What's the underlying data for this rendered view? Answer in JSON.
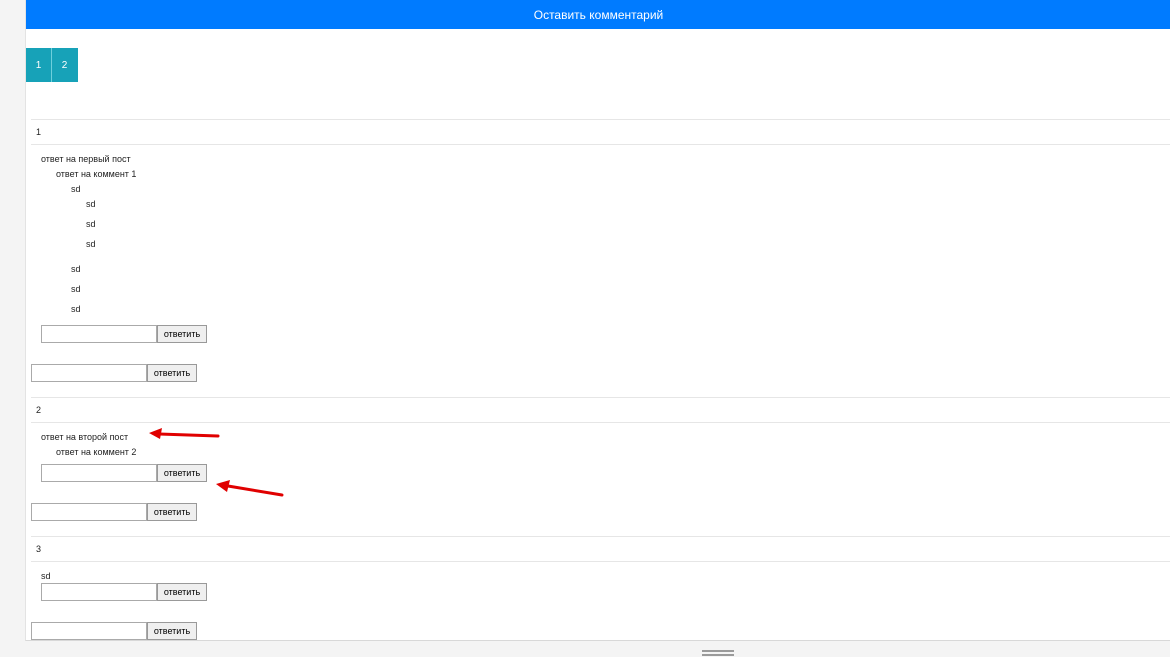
{
  "header": {
    "leave_comment_label": "Оставить комментарий"
  },
  "pagination": {
    "pages": [
      "1",
      "2"
    ]
  },
  "posts": [
    {
      "number": "1",
      "comments": [
        "ответ на первый пост",
        "ответ на коммент 1",
        "sd",
        "sd",
        "sd",
        "sd",
        "sd",
        "sd",
        "sd"
      ]
    },
    {
      "number": "2",
      "comments": [
        "ответ на второй пост",
        "ответ на коммент 2"
      ]
    },
    {
      "number": "3",
      "comments": [
        "sd"
      ]
    }
  ],
  "reply_form": {
    "button_label": "ответить",
    "input_value": ""
  },
  "annotation_color": "#e00000"
}
